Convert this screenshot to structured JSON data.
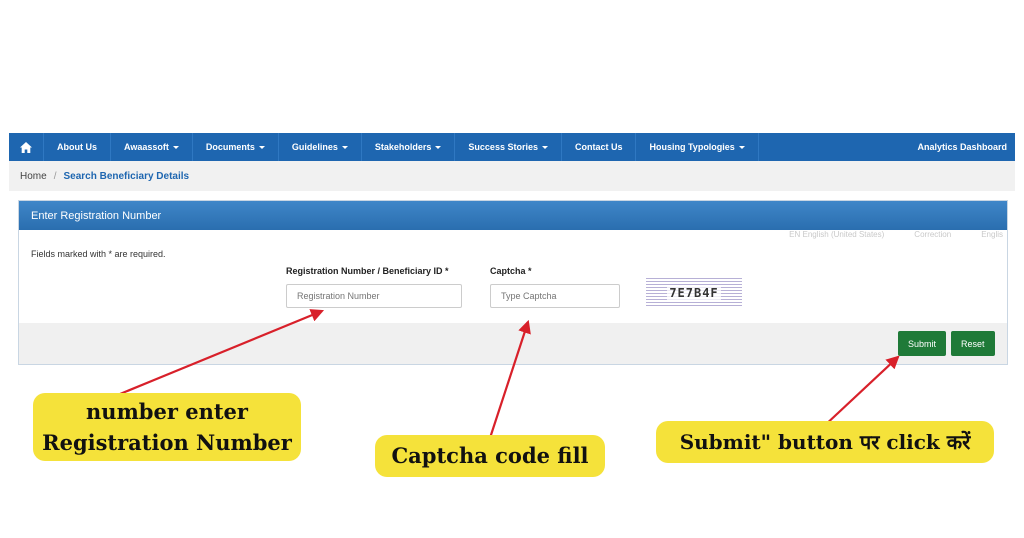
{
  "nav": {
    "home_icon": "home-icon",
    "items": [
      {
        "label": "About Us",
        "dropdown": false
      },
      {
        "label": "Awaassoft",
        "dropdown": true
      },
      {
        "label": "Documents",
        "dropdown": true
      },
      {
        "label": "Guidelines",
        "dropdown": true
      },
      {
        "label": "Stakeholders",
        "dropdown": true
      },
      {
        "label": "Success Stories",
        "dropdown": true
      },
      {
        "label": "Contact Us",
        "dropdown": false
      },
      {
        "label": "Housing Typologies",
        "dropdown": true
      }
    ],
    "right_link": "Analytics Dashboard",
    "bg_color": "#1e66b0"
  },
  "breadcrumb": {
    "home": "Home",
    "separator": "/",
    "current": "Search Beneficiary Details"
  },
  "panel": {
    "title": "Enter Registration Number",
    "language_strip": [
      "EN English (United States)",
      "Correction",
      "Englis"
    ],
    "required_note": "Fields marked with * are required.",
    "registration": {
      "label": "Registration Number / Beneficiary ID *",
      "placeholder": "Registration Number",
      "value": ""
    },
    "captcha": {
      "label": "Captcha *",
      "placeholder": "Type Captcha",
      "value": "",
      "code": "7E7B4F"
    },
    "buttons": {
      "submit": "Submit",
      "reset": "Reset"
    },
    "button_color": "#1f7a38"
  },
  "annotations": {
    "registration": [
      "number enter",
      "Registration Number"
    ],
    "captcha": "Captcha code fill",
    "submit": "Submit\" button पर click करें",
    "callout_color": "#f5e23a",
    "arrow_color": "#d8202a"
  }
}
